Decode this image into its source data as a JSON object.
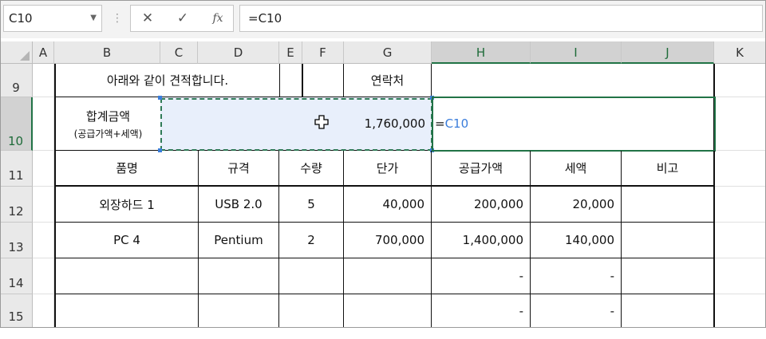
{
  "formula_bar": {
    "name_box": "C10",
    "cancel_icon": "✕",
    "enter_icon": "✓",
    "fx_icon": "fx",
    "formula": "=C10"
  },
  "columns": [
    "A",
    "B",
    "C",
    "D",
    "E",
    "F",
    "G",
    "H",
    "I",
    "J",
    "K"
  ],
  "rows": [
    "9",
    "10",
    "11",
    "12",
    "13",
    "14",
    "15"
  ],
  "sheet": {
    "r9_text": "아래와 같이 견적합니다.",
    "r9_contact": "연락처",
    "r10_label1": "합계금액",
    "r10_label2": "(공급가액+세액)",
    "r10_total": "1,760,000",
    "r10_formula_eq": "=",
    "r10_formula_ref": "C10",
    "header": [
      "품명",
      "규격",
      "수량",
      "단가",
      "공급가액",
      "세액",
      "비고"
    ],
    "row12": [
      "외장하드 1",
      "USB 2.0",
      "5",
      "40,000",
      "200,000",
      "20,000",
      ""
    ],
    "row13": [
      "PC 4",
      "Pentium",
      "2",
      "700,000",
      "1,400,000",
      "140,000",
      ""
    ],
    "row14": [
      "",
      "",
      "",
      "",
      "-",
      "-",
      ""
    ],
    "row15": [
      "",
      "",
      "",
      "",
      "-",
      "-",
      ""
    ]
  },
  "colors": {
    "selection_green": "#217346",
    "marching_ants": "#2f7a57",
    "copy_fill": "#e8effb",
    "ref_blue": "#3a7ddb"
  }
}
